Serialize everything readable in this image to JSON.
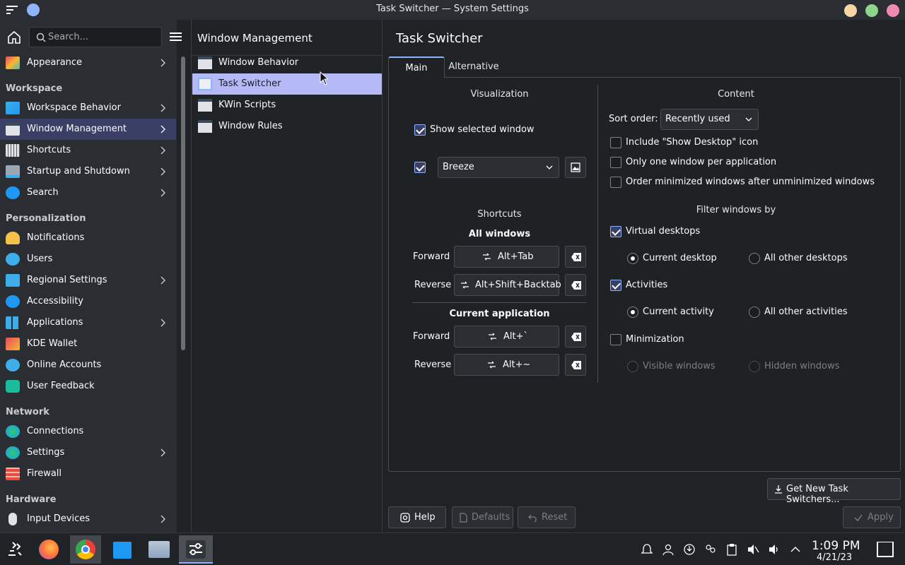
{
  "window": {
    "title": "Task Switcher — System Settings"
  },
  "colors": {
    "accent": "#8fb4ff",
    "selection": "#b5b9f5",
    "minimize": "#f5d6a4",
    "maximize": "#8ed48a",
    "close": "#f08bb0"
  },
  "sidebar": {
    "search_placeholder": "Search...",
    "top_item": {
      "label": "Appearance",
      "icon": "appearance-icon"
    },
    "sections": {
      "workspace": "Workspace",
      "personalization": "Personalization",
      "network": "Network",
      "hardware": "Hardware"
    },
    "workspace_items": [
      {
        "label": "Workspace Behavior"
      },
      {
        "label": "Window Management"
      },
      {
        "label": "Shortcuts"
      },
      {
        "label": "Startup and Shutdown"
      },
      {
        "label": "Search"
      }
    ],
    "personalization_items": [
      {
        "label": "Notifications"
      },
      {
        "label": "Users"
      },
      {
        "label": "Regional Settings"
      },
      {
        "label": "Accessibility"
      },
      {
        "label": "Applications"
      },
      {
        "label": "KDE Wallet"
      },
      {
        "label": "Online Accounts"
      },
      {
        "label": "User Feedback"
      }
    ],
    "network_items": [
      {
        "label": "Connections"
      },
      {
        "label": "Settings"
      },
      {
        "label": "Firewall"
      }
    ],
    "hardware_items": [
      {
        "label": "Input Devices"
      }
    ]
  },
  "middle": {
    "title": "Window Management",
    "items": [
      {
        "label": "Window Behavior"
      },
      {
        "label": "Task Switcher"
      },
      {
        "label": "KWin Scripts"
      },
      {
        "label": "Window Rules"
      }
    ]
  },
  "main": {
    "title": "Task Switcher",
    "tabs": [
      {
        "label": "Main"
      },
      {
        "label": "Alternative"
      }
    ],
    "visualization": {
      "title": "Visualization",
      "show_selected_window": "Show selected window",
      "theme_value": "Breeze"
    },
    "shortcuts": {
      "title": "Shortcuts",
      "all_windows": "All windows",
      "current_application": "Current application",
      "forward": "Forward",
      "reverse": "Reverse",
      "all_forward_key": "Alt+Tab",
      "all_reverse_key": "Alt+Shift+Backtab",
      "app_forward_key": "Alt+`",
      "app_reverse_key": "Alt+~"
    },
    "content": {
      "title": "Content",
      "sort_order_label": "Sort order:",
      "sort_order_value": "Recently used",
      "include_show_desktop": "Include \"Show Desktop\" icon",
      "one_window_per_app": "Only one window per application",
      "order_minimized": "Order minimized windows after unminimized windows",
      "filter_title": "Filter windows by",
      "virtual_desktops": "Virtual desktops",
      "current_desktop": "Current desktop",
      "all_other_desktops": "All other desktops",
      "activities": "Activities",
      "current_activity": "Current activity",
      "all_other_activities": "All other activities",
      "minimization": "Minimization",
      "visible_windows": "Visible windows",
      "hidden_windows": "Hidden windows"
    },
    "get_new": "Get New Task Switchers...",
    "buttons": {
      "help": "Help",
      "defaults": "Defaults",
      "reset": "Reset",
      "apply": "Apply"
    }
  },
  "taskbar": {
    "time": "1:09 PM",
    "date": "4/21/23"
  }
}
